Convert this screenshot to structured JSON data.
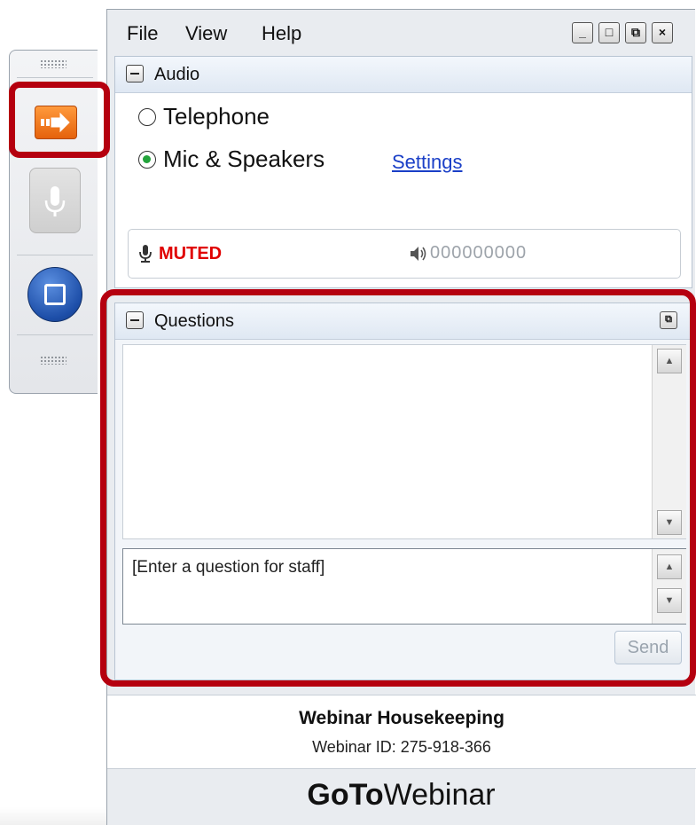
{
  "menu": {
    "file": "File",
    "view": "View",
    "help": "Help"
  },
  "window_buttons": {
    "minimize": "_",
    "maximize": "□",
    "restore": "⧉",
    "close": "×"
  },
  "audio": {
    "title": "Audio",
    "options": [
      {
        "label": "Telephone",
        "selected": false
      },
      {
        "label": "Mic & Speakers",
        "selected": true
      }
    ],
    "settings_link": "Settings",
    "mic_status": "MUTED",
    "speaker_level": "000000000"
  },
  "questions": {
    "title": "Questions",
    "input_placeholder": "[Enter a question for staff]",
    "send_label": "Send"
  },
  "footer": {
    "title": "Webinar Housekeeping",
    "webinar_id": "Webinar ID: 275-918-366"
  },
  "brand": {
    "bold": "GoTo",
    "light": "Webinar"
  },
  "colors": {
    "highlight": "#b5000f",
    "muted": "#e00000",
    "link": "#1a3fc7",
    "arrow_button": "#e5620c",
    "screen_button": "#1d4ea8"
  },
  "icons": [
    "arrow-right-icon",
    "microphone-icon",
    "screen-share-icon",
    "speaker-icon",
    "minus-icon",
    "pop-out-icon"
  ]
}
